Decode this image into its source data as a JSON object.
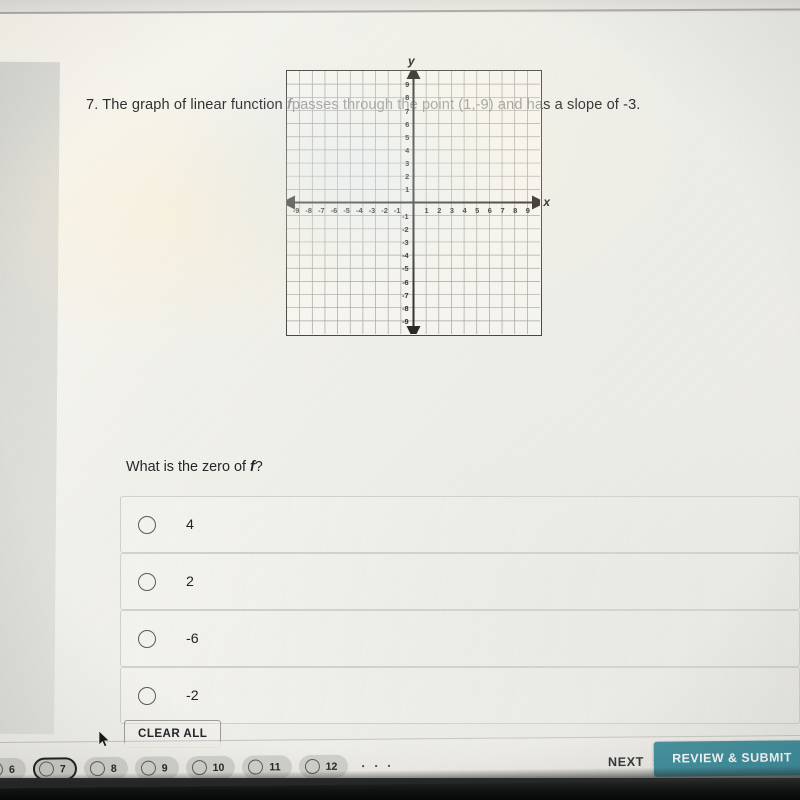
{
  "question": {
    "number_label": "7.",
    "stem_part1": "The graph of linear function",
    "stem_variable": "f",
    "stem_part2": "passes through the point (1,-9) and has a slope of -3.",
    "sub_prompt_part1": "What is the zero of",
    "sub_prompt_variable": "f",
    "sub_prompt_part2": "?"
  },
  "graph": {
    "x_axis_label": "x",
    "y_axis_label": "y",
    "x_ticks": [
      "-9",
      "-8",
      "-7",
      "-6",
      "-5",
      "-4",
      "-3",
      "-2",
      "-1",
      "1",
      "2",
      "3",
      "4",
      "5",
      "6",
      "7",
      "8",
      "9"
    ],
    "y_ticks_positive": [
      "9",
      "8",
      "7",
      "6",
      "5",
      "4",
      "3",
      "2",
      "1"
    ],
    "y_ticks_negative": [
      "-1",
      "-2",
      "-3",
      "-4",
      "-5",
      "-6",
      "-7",
      "-8",
      "-9"
    ],
    "x_min": -10,
    "x_max": 10,
    "y_min": -10,
    "y_max": 10,
    "grid_step": 1
  },
  "options": [
    {
      "label": "4",
      "selected": false
    },
    {
      "label": "2",
      "selected": false
    },
    {
      "label": "-6",
      "selected": false
    },
    {
      "label": "-2",
      "selected": false
    }
  ],
  "eliminate_icon": "circled-minus-icon",
  "toolbar": {
    "clear_all_label": "CLEAR ALL"
  },
  "footer": {
    "pills": [
      {
        "number": "6",
        "active": false
      },
      {
        "number": "7",
        "active": true
      },
      {
        "number": "8",
        "active": false
      },
      {
        "number": "9",
        "active": false
      },
      {
        "number": "10",
        "active": false
      },
      {
        "number": "11",
        "active": false
      },
      {
        "number": "12",
        "active": false
      }
    ],
    "ellipsis": "· · ·",
    "next_label": "NEXT",
    "next_chevron": "›",
    "review_submit_label": "REVIEW & SUBMIT"
  },
  "colors": {
    "accent_teal": "#2e8595",
    "text_primary": "#222227",
    "grid_line": "#9a9890",
    "axis_line": "#33322e",
    "frame": "#4b4944"
  }
}
